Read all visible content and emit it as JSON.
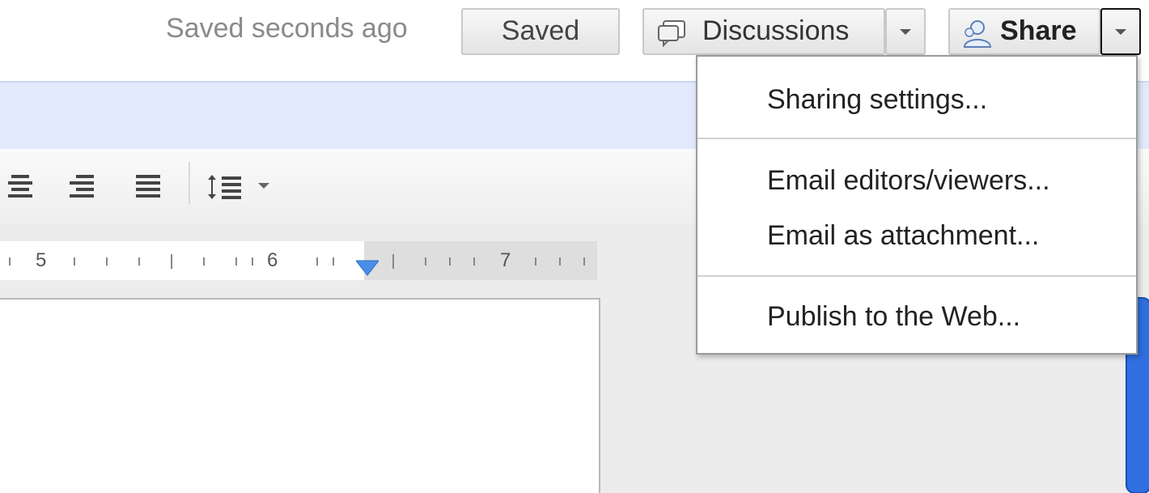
{
  "header": {
    "save_status": "Saved seconds ago",
    "saved_button": "Saved",
    "discussions_button": "Discussions",
    "share_button": "Share"
  },
  "ruler": {
    "numbers": [
      "5",
      "6",
      "7"
    ]
  },
  "share_menu": {
    "items": [
      {
        "label": "Sharing settings..."
      },
      {
        "label": "Email editors/viewers..."
      },
      {
        "label": "Email as attachment..."
      },
      {
        "label": "Publish to the Web..."
      }
    ]
  },
  "colors": {
    "accent_blue": "#e1e9fb",
    "indent_marker": "#4a8ee8"
  },
  "icons": [
    "discussions-icon",
    "share-person-icon",
    "align-center-icon",
    "align-right-icon",
    "justify-icon",
    "line-spacing-icon",
    "indent-marker-icon"
  ]
}
